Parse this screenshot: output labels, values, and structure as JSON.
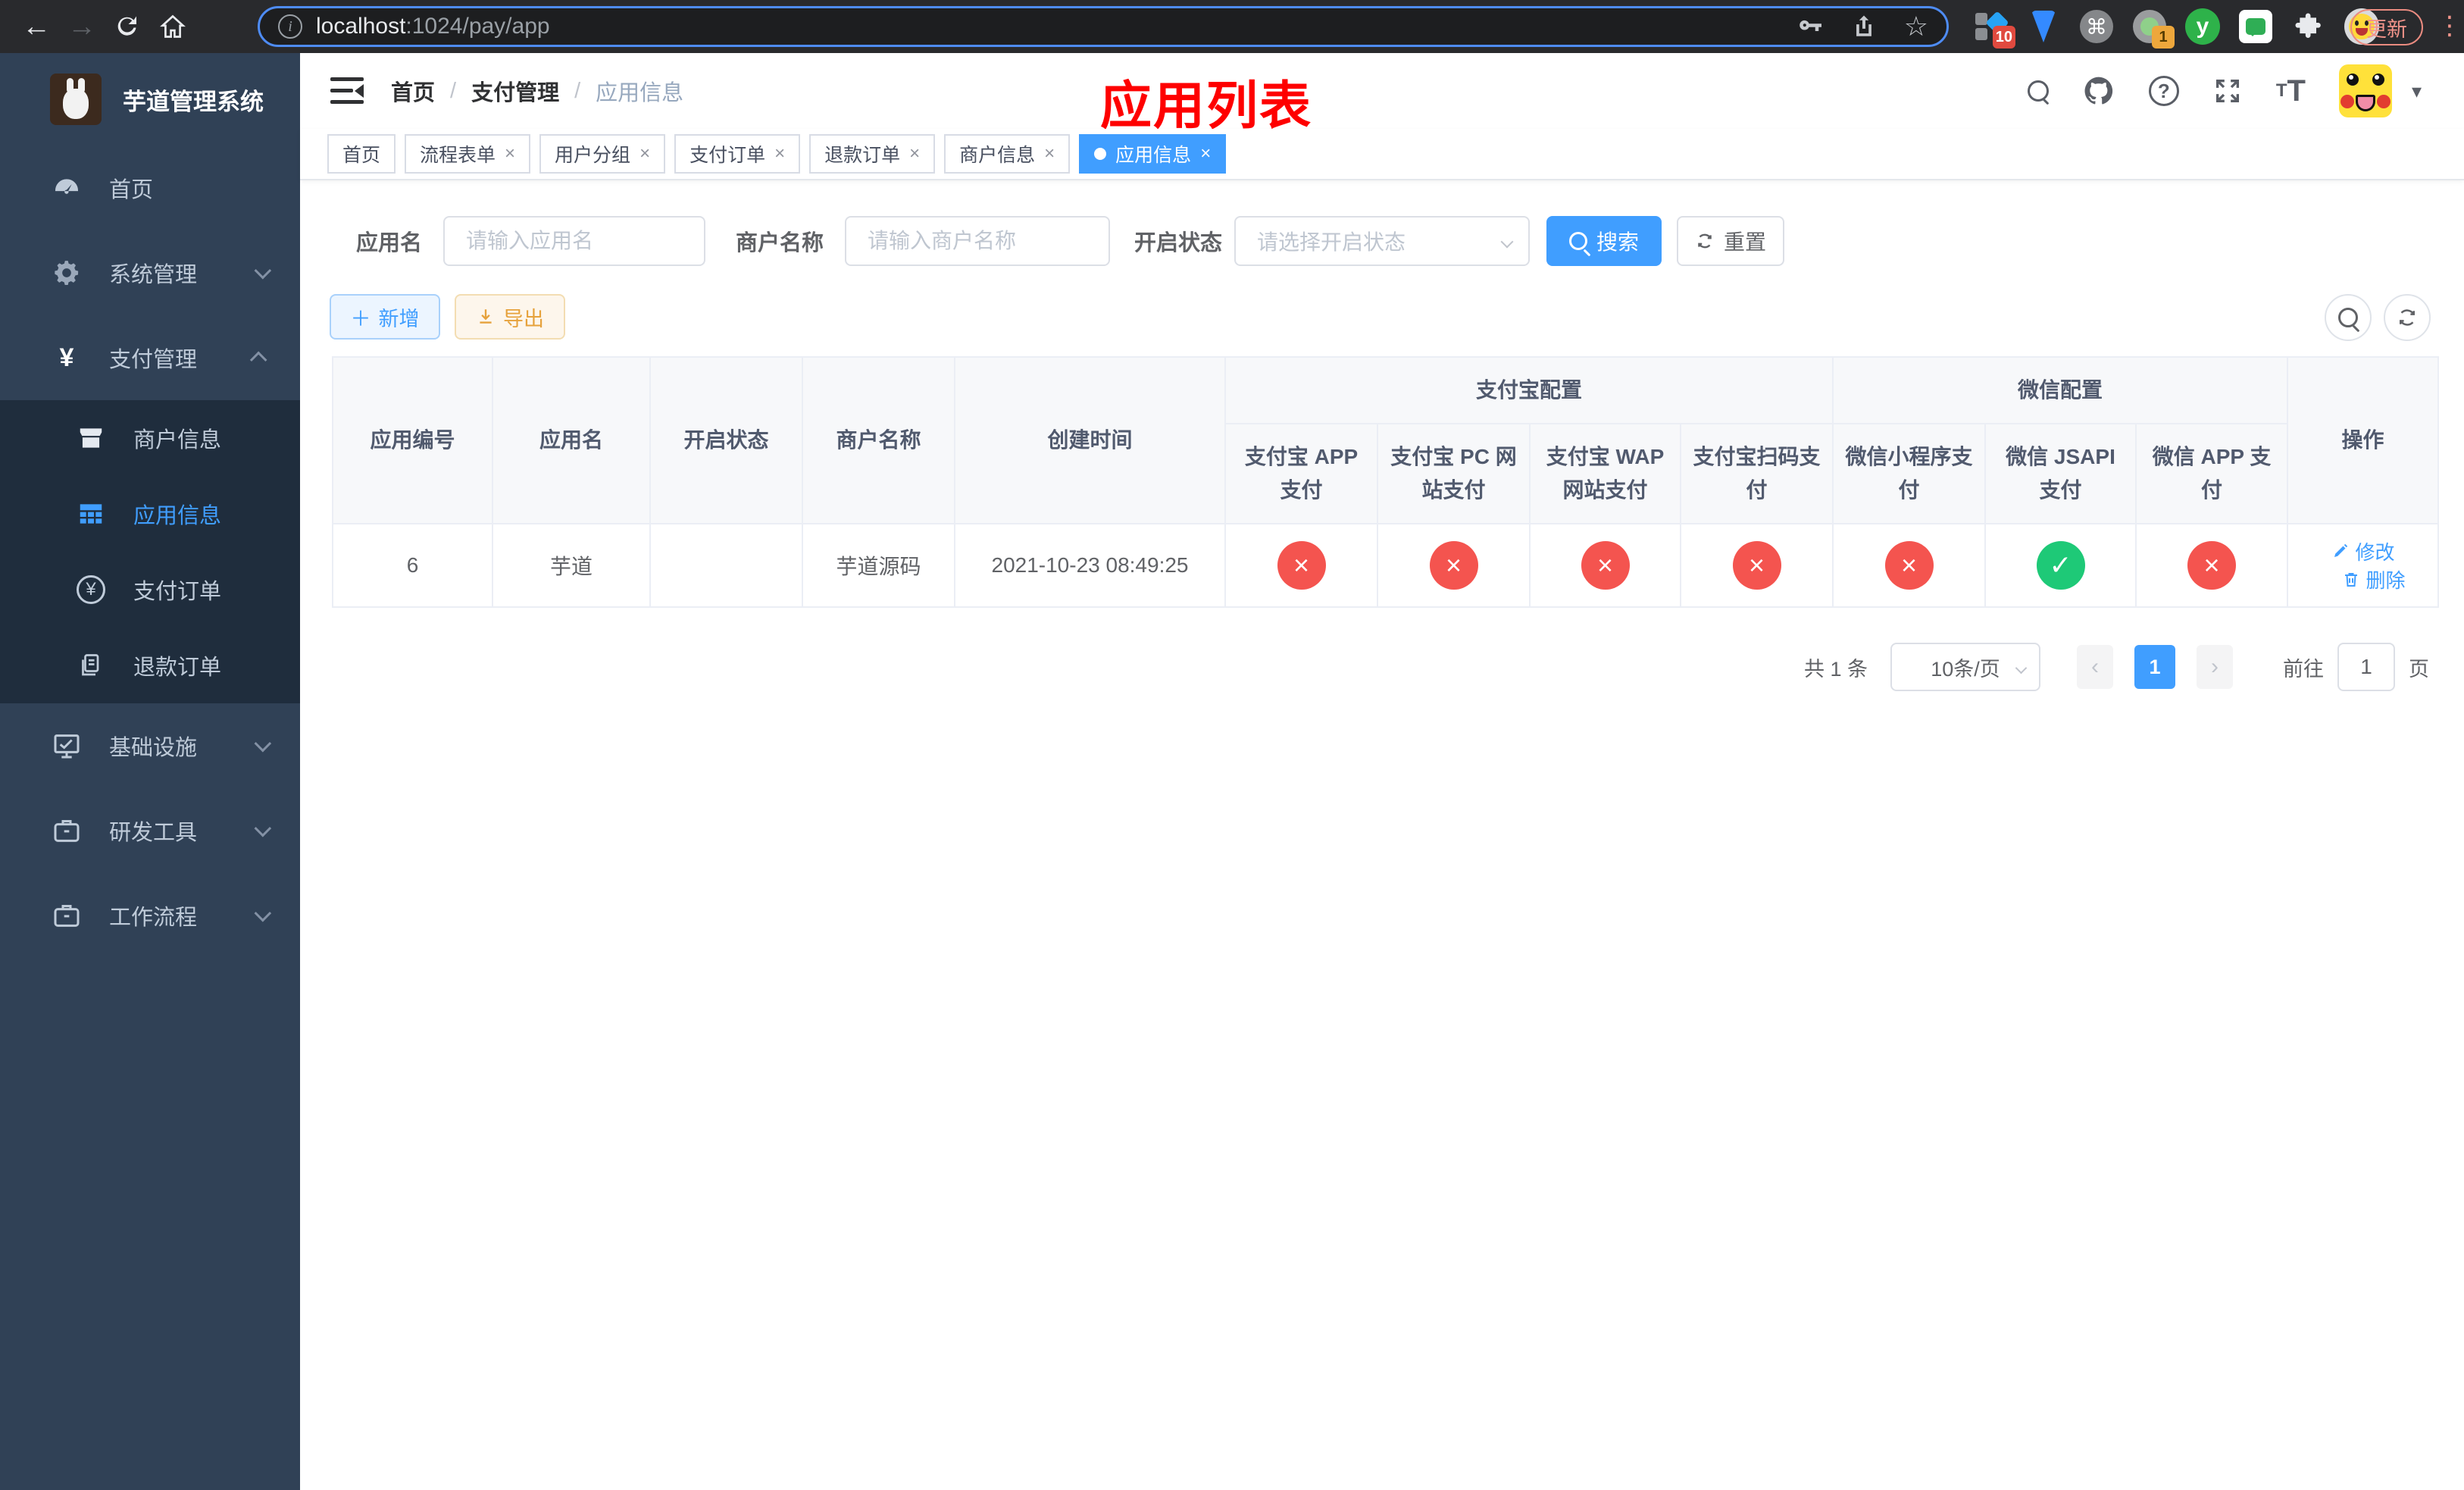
{
  "browser": {
    "url_host": "localhost",
    "url_path": ":1024/pay/app",
    "update_label": "更新",
    "ext_badge_blue": "10",
    "ext_badge_circle": "1",
    "ext_y_label": "y"
  },
  "sidebar": {
    "title": "芋道管理系统",
    "items": [
      {
        "label": "首页"
      },
      {
        "label": "系统管理"
      },
      {
        "label": "支付管理"
      },
      {
        "label": "商户信息"
      },
      {
        "label": "应用信息"
      },
      {
        "label": "支付订单"
      },
      {
        "label": "退款订单"
      },
      {
        "label": "基础设施"
      },
      {
        "label": "研发工具"
      },
      {
        "label": "工作流程"
      }
    ]
  },
  "header": {
    "breadcrumb": [
      "首页",
      "支付管理",
      "应用信息"
    ],
    "separator": "/",
    "annotation": "应用列表"
  },
  "tabs": [
    {
      "label": "首页"
    },
    {
      "label": "流程表单"
    },
    {
      "label": "用户分组"
    },
    {
      "label": "支付订单"
    },
    {
      "label": "退款订单"
    },
    {
      "label": "商户信息"
    },
    {
      "label": "应用信息"
    }
  ],
  "filters": {
    "app_name_label": "应用名",
    "app_name_placeholder": "请输入应用名",
    "merchant_label": "商户名称",
    "merchant_placeholder": "请输入商户名称",
    "status_label": "开启状态",
    "status_placeholder": "请选择开启状态",
    "search_label": "搜索",
    "reset_label": "重置"
  },
  "toolbar": {
    "add_label": "新增",
    "export_label": "导出"
  },
  "table": {
    "group_alipay": "支付宝配置",
    "group_wechat": "微信配置",
    "columns": [
      "应用编号",
      "应用名",
      "开启状态",
      "商户名称",
      "创建时间",
      "支付宝 APP 支付",
      "支付宝 PC 网站支付",
      "支付宝 WAP 网站支付",
      "支付宝扫码支付",
      "微信小程序支付",
      "微信 JSAPI 支付",
      "微信 APP 支付",
      "操作"
    ],
    "row": {
      "id": "6",
      "name": "芋道",
      "enabled": true,
      "merchant": "芋道源码",
      "created": "2021-10-23 08:49:25",
      "statuses": [
        "fail",
        "fail",
        "fail",
        "fail",
        "fail",
        "success",
        "fail"
      ],
      "edit_label": "修改",
      "delete_label": "删除"
    }
  },
  "pagination": {
    "total": "共 1 条",
    "page_size": "10条/页",
    "page": "1",
    "goto_label": "前往",
    "goto_value": "1",
    "unit_label": "页"
  },
  "icons": {
    "close": "×",
    "check": "✓",
    "cross": "×",
    "plus": "＋",
    "back": "←",
    "forward": "→",
    "star": "☆",
    "command": "⌘",
    "dots": "⋮",
    "caret": "▾",
    "prev": "‹",
    "next": "›",
    "yen": "¥",
    "question": "?",
    "info": "i"
  },
  "colors": {
    "primary": "#409eff",
    "success": "#1ec977",
    "danger": "#f4544f",
    "warning": "#e6a23c",
    "sidebar_bg": "#304156",
    "submenu_bg": "#1f2d3d",
    "annotation_red": "#fe0000"
  }
}
